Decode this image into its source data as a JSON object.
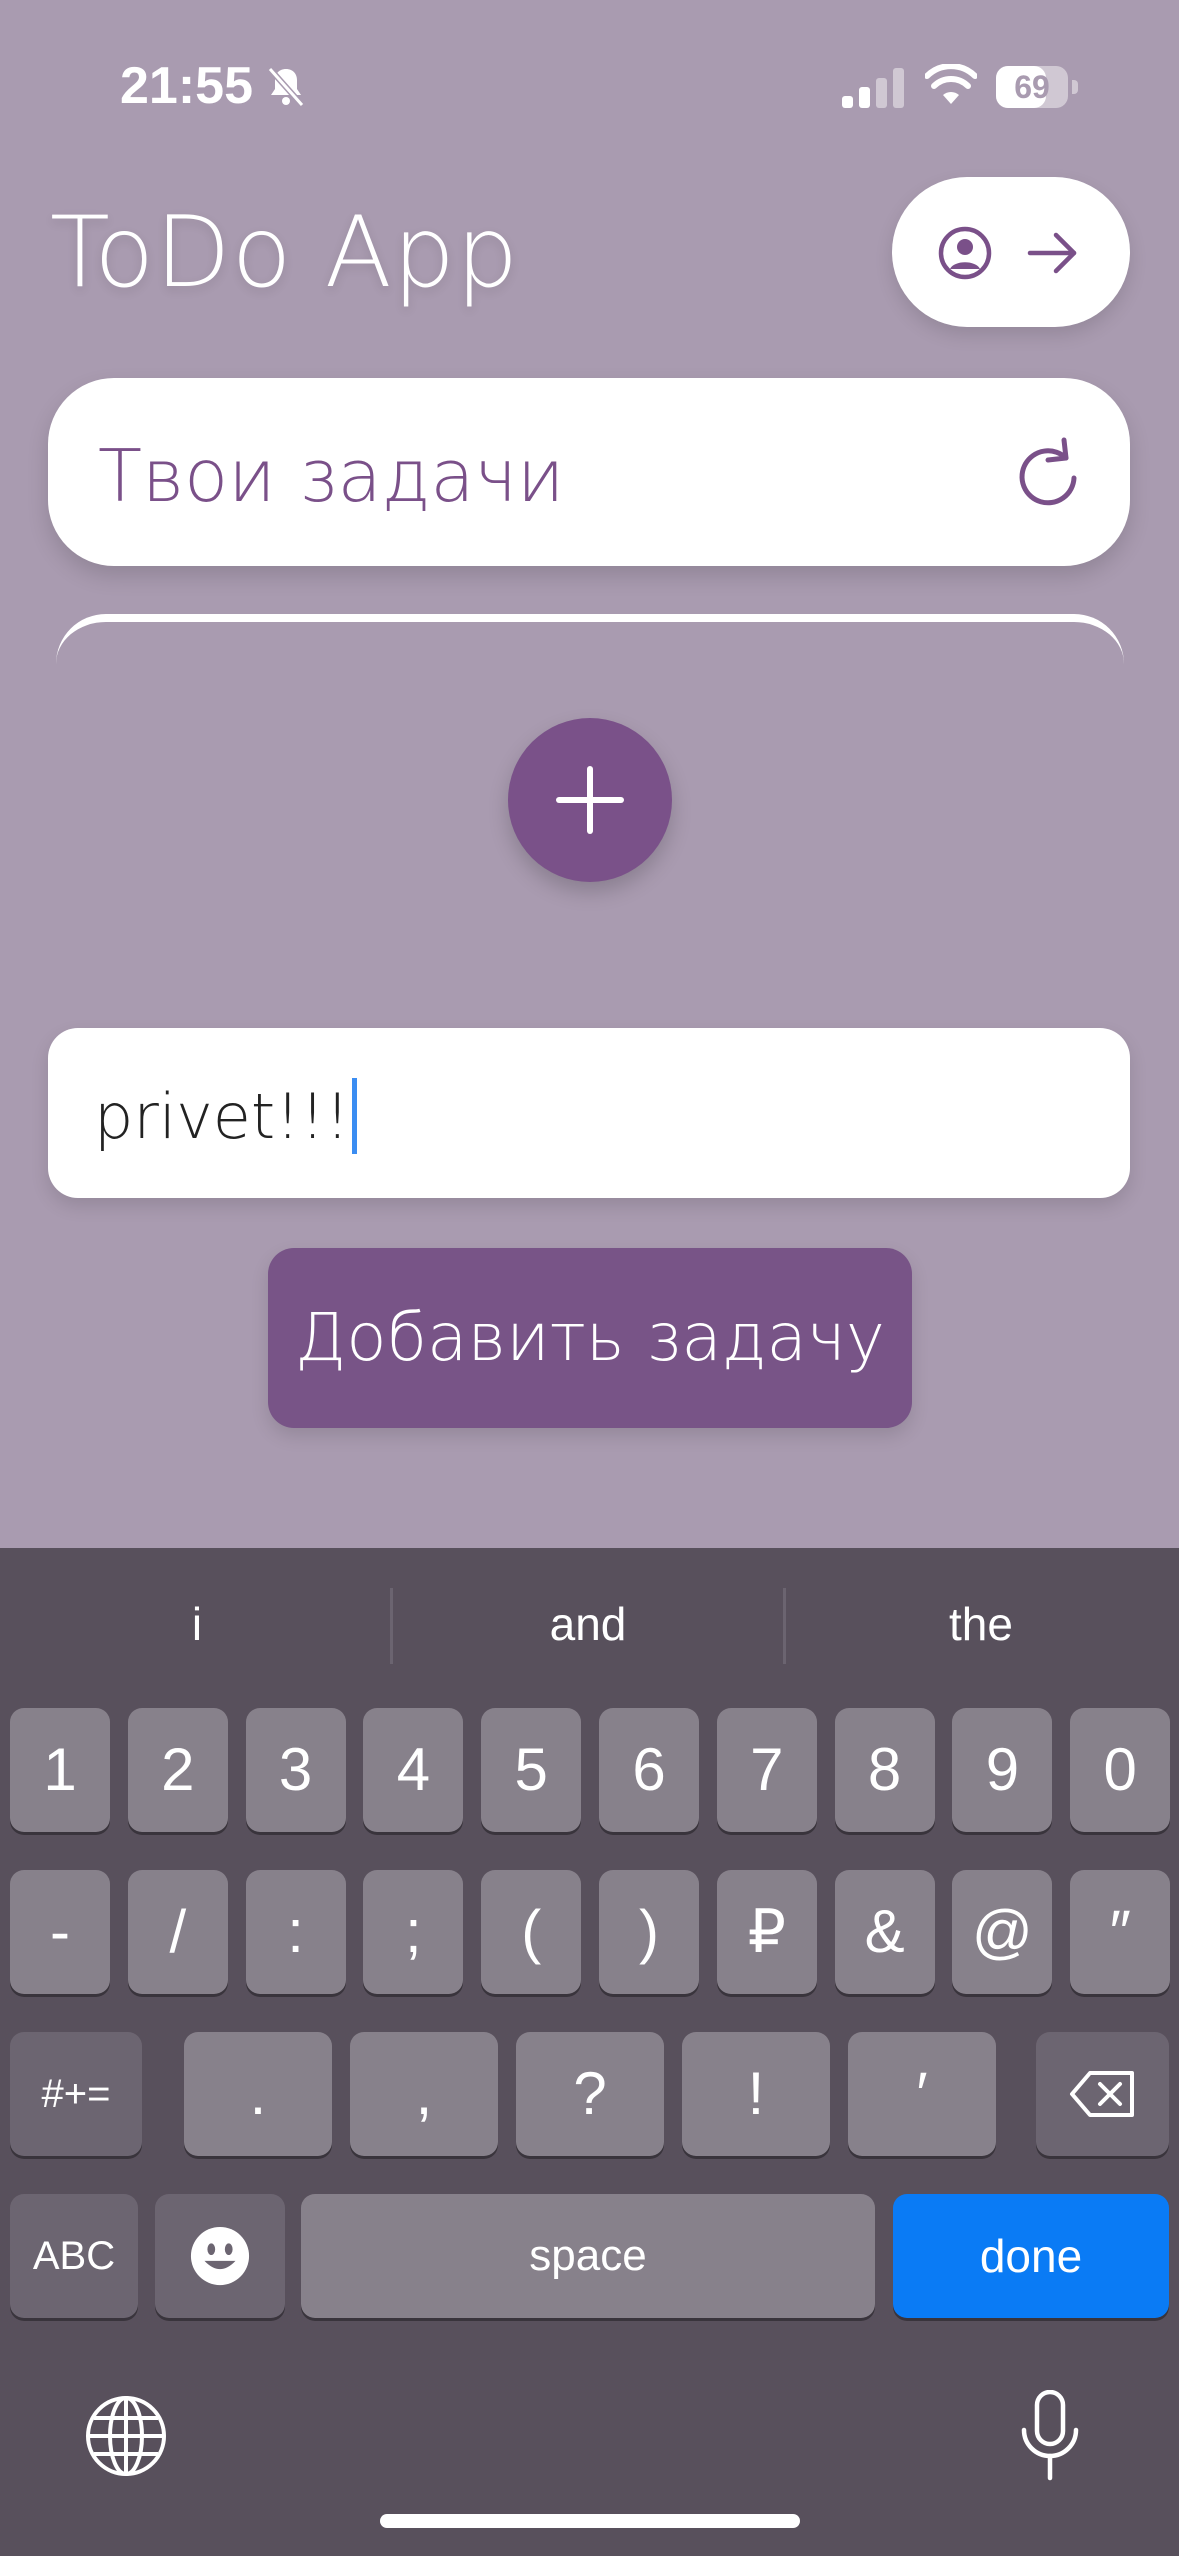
{
  "status_bar": {
    "time": "21:55",
    "battery": "69",
    "battery_level": 0.69,
    "icons": [
      "bell-slash-icon",
      "cellular-signal-icon",
      "wifi-icon",
      "battery-icon"
    ]
  },
  "header": {
    "title": "ToDo App",
    "icons": [
      "user-circle-icon",
      "arrow-right-icon"
    ]
  },
  "tasks_card": {
    "title": "Твои задачи",
    "icon": "refresh-icon"
  },
  "fab": {
    "icon": "plus-icon"
  },
  "input": {
    "value": "privet!!!"
  },
  "add_button": {
    "label": "Добавить задачу"
  },
  "keyboard": {
    "suggestions": [
      "i",
      "and",
      "the"
    ],
    "row1": [
      "1",
      "2",
      "3",
      "4",
      "5",
      "6",
      "7",
      "8",
      "9",
      "0"
    ],
    "row2": [
      "-",
      "/",
      ":",
      ";",
      "(",
      ")",
      "₽",
      "&",
      "@",
      "″"
    ],
    "row3": [
      "#+=",
      ".",
      ",",
      "?",
      "!",
      "′"
    ],
    "row4": {
      "abc": "ABC",
      "space": "space",
      "done": "done"
    },
    "icons": [
      "backspace-icon",
      "emoji-icon",
      "globe-icon",
      "microphone-icon"
    ]
  },
  "colors": {
    "background": "#a99bb0",
    "accent": "#7a5189",
    "keyboard": "#58505c",
    "done": "#0a7bf5"
  }
}
